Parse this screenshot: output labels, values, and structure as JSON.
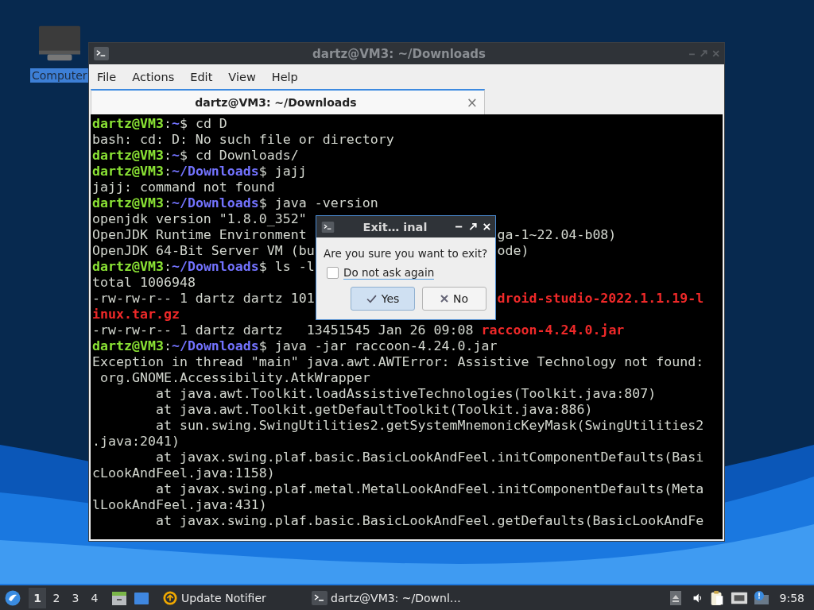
{
  "desktop_icons": [
    {
      "label": "Computer",
      "selected": true
    }
  ],
  "terminal": {
    "title": "dartz@VM3: ~/Downloads",
    "menu": [
      "File",
      "Actions",
      "Edit",
      "View",
      "Help"
    ],
    "tabs": [
      {
        "label": "dartz@VM3: ~/Downloads",
        "selected": true,
        "close": "×"
      }
    ],
    "lines": [
      {
        "segments": [
          {
            "kind": "user",
            "text": "dartz@VM3"
          },
          {
            "kind": "plain",
            "text": ":"
          },
          {
            "kind": "path",
            "text": "~"
          },
          {
            "kind": "plain",
            "text": "$ cd D"
          }
        ]
      },
      {
        "segments": [
          {
            "kind": "plain",
            "text": "bash: cd: D: No such file or directory"
          }
        ]
      },
      {
        "segments": [
          {
            "kind": "user",
            "text": "dartz@VM3"
          },
          {
            "kind": "plain",
            "text": ":"
          },
          {
            "kind": "path",
            "text": "~"
          },
          {
            "kind": "plain",
            "text": "$ cd Downloads/"
          }
        ]
      },
      {
        "segments": [
          {
            "kind": "user",
            "text": "dartz@VM3"
          },
          {
            "kind": "plain",
            "text": ":"
          },
          {
            "kind": "path",
            "text": "~/Downloads"
          },
          {
            "kind": "plain",
            "text": "$ jajj"
          }
        ]
      },
      {
        "segments": [
          {
            "kind": "plain",
            "text": "jajj: command not found"
          }
        ]
      },
      {
        "segments": [
          {
            "kind": "user",
            "text": "dartz@VM3"
          },
          {
            "kind": "plain",
            "text": ":"
          },
          {
            "kind": "path",
            "text": "~/Downloads"
          },
          {
            "kind": "plain",
            "text": "$ java -version"
          }
        ]
      },
      {
        "segments": [
          {
            "kind": "plain",
            "text": "openjdk version \"1.8.0_352\""
          }
        ]
      },
      {
        "segments": [
          {
            "kind": "plain",
            "text": "OpenJDK Runtime Environment"
          }
        ],
        "after_dialog": [
          {
            "kind": "plain",
            "text": "ga-1~22.04-b08)"
          }
        ]
      },
      {
        "segments": [
          {
            "kind": "plain",
            "text": "OpenJDK 64-Bit Server VM (bu"
          }
        ],
        "after_dialog": [
          {
            "kind": "plain",
            "text": "ode)"
          }
        ]
      },
      {
        "segments": [
          {
            "kind": "user",
            "text": "dartz@VM3"
          },
          {
            "kind": "plain",
            "text": ":"
          },
          {
            "kind": "path",
            "text": "~/Downloads"
          },
          {
            "kind": "plain",
            "text": "$ ls -l"
          }
        ]
      },
      {
        "segments": [
          {
            "kind": "plain",
            "text": "total 1006948"
          }
        ]
      },
      {
        "segments": [
          {
            "kind": "plain",
            "text": "-rw-rw-r-- 1 dartz dartz 101"
          }
        ],
        "after_dialog": [
          {
            "kind": "file",
            "text": "droid-studio-2022.1.1.19-l"
          }
        ]
      },
      {
        "segments": [
          {
            "kind": "file",
            "text": "inux.tar.gz"
          }
        ]
      },
      {
        "segments": [
          {
            "kind": "plain",
            "text": "-rw-rw-r-- 1 dartz dartz   13451545 Jan 26 09:08 "
          },
          {
            "kind": "file",
            "text": "raccoon-4.24.0.jar"
          }
        ]
      },
      {
        "segments": [
          {
            "kind": "user",
            "text": "dartz@VM3"
          },
          {
            "kind": "plain",
            "text": ":"
          },
          {
            "kind": "path",
            "text": "~/Downloads"
          },
          {
            "kind": "plain",
            "text": "$ java -jar raccoon-4.24.0.jar"
          }
        ]
      },
      {
        "segments": [
          {
            "kind": "plain",
            "text": "Exception in thread \"main\" java.awt.AWTError: Assistive Technology not found:"
          }
        ]
      },
      {
        "segments": [
          {
            "kind": "plain",
            "text": " org.GNOME.Accessibility.AtkWrapper"
          }
        ]
      },
      {
        "segments": [
          {
            "kind": "plain",
            "text": "        at java.awt.Toolkit.loadAssistiveTechnologies(Toolkit.java:807)"
          }
        ]
      },
      {
        "segments": [
          {
            "kind": "plain",
            "text": "        at java.awt.Toolkit.getDefaultToolkit(Toolkit.java:886)"
          }
        ]
      },
      {
        "segments": [
          {
            "kind": "plain",
            "text": "        at sun.swing.SwingUtilities2.getSystemMnemonicKeyMask(SwingUtilities2"
          }
        ]
      },
      {
        "segments": [
          {
            "kind": "plain",
            "text": ".java:2041)"
          }
        ]
      },
      {
        "segments": [
          {
            "kind": "plain",
            "text": "        at javax.swing.plaf.basic.BasicLookAndFeel.initComponentDefaults(Basi"
          }
        ]
      },
      {
        "segments": [
          {
            "kind": "plain",
            "text": "cLookAndFeel.java:1158)"
          }
        ]
      },
      {
        "segments": [
          {
            "kind": "plain",
            "text": "        at javax.swing.plaf.metal.MetalLookAndFeel.initComponentDefaults(Meta"
          }
        ]
      },
      {
        "segments": [
          {
            "kind": "plain",
            "text": "lLookAndFeel.java:431)"
          }
        ]
      },
      {
        "segments": [
          {
            "kind": "plain",
            "text": "        at javax.swing.plaf.basic.BasicLookAndFeel.getDefaults(BasicLookAndFe"
          }
        ]
      }
    ]
  },
  "dialog": {
    "title": "Exit… inal",
    "message": "Are you sure you want to exit?",
    "checkbox": {
      "label": "Do not ask again",
      "checked": false
    },
    "buttons": [
      {
        "label": "Yes",
        "kind": "yes",
        "default": true
      },
      {
        "label": "No",
        "kind": "no",
        "default": false
      }
    ]
  },
  "taskbar": {
    "workspaces": [
      {
        "label": "1",
        "selected": true
      },
      {
        "label": "2",
        "selected": false
      },
      {
        "label": "3",
        "selected": false
      },
      {
        "label": "4",
        "selected": false
      }
    ],
    "tasks": [
      {
        "label": "Update Notifier",
        "kind": "notifier"
      },
      {
        "label": "dartz@VM3: ~/Downl…",
        "kind": "terminal"
      }
    ],
    "clock": "9:58"
  }
}
